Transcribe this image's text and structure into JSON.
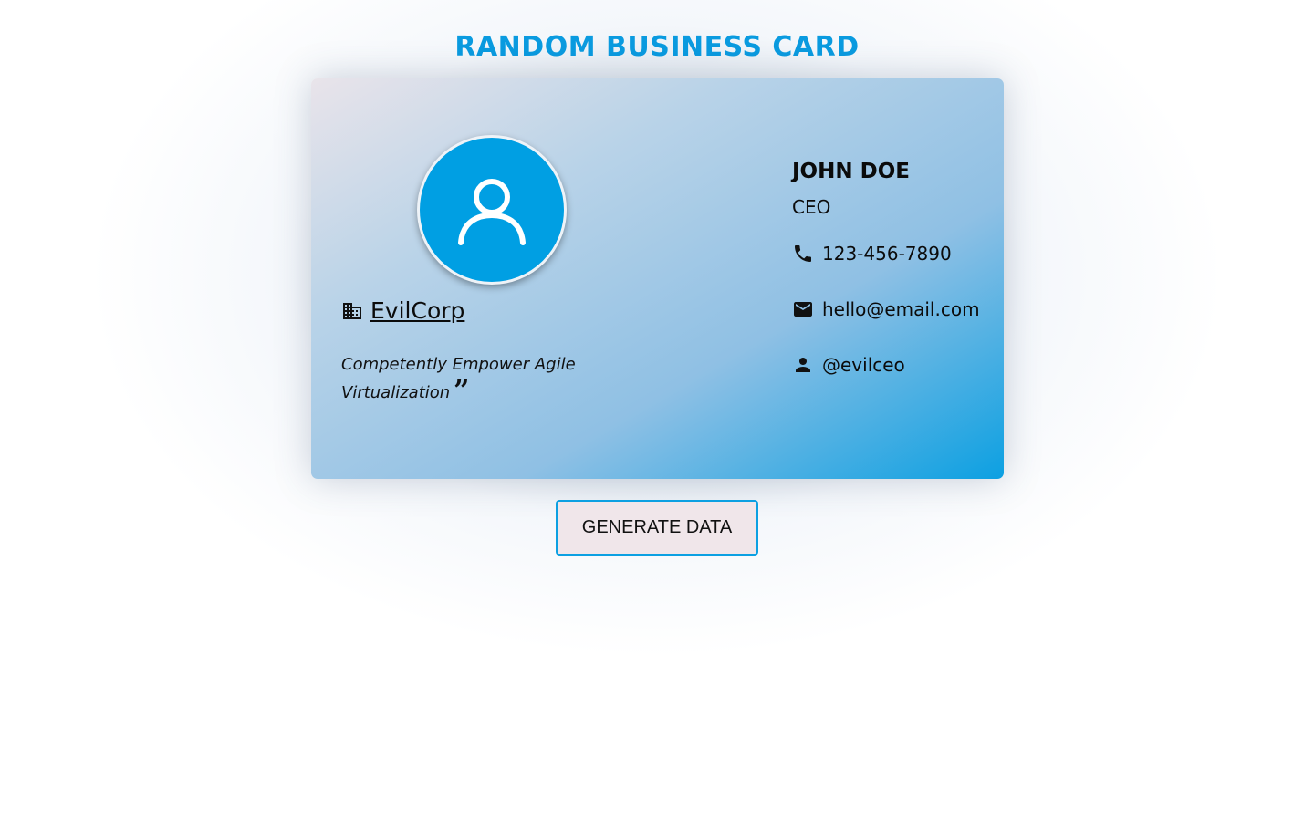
{
  "header": {
    "title": "RANDOM BUSINESS CARD"
  },
  "card": {
    "avatar_icon": "user-outline-icon",
    "company": {
      "icon": "building-icon",
      "name": "EvilCorp"
    },
    "slogan": "Competently Empower Agile Virtualization",
    "quote_icon": "closing-quote-icon",
    "person": {
      "name": "JOHN DOE",
      "role": "CEO"
    },
    "contacts": {
      "phone": {
        "icon": "phone-icon",
        "value": "123-456-7890"
      },
      "email": {
        "icon": "mail-icon",
        "value": "hello@email.com"
      },
      "handle": {
        "icon": "person-icon",
        "value": "@evilceo"
      }
    }
  },
  "actions": {
    "generate_label": "GENERATE DATA"
  },
  "colors": {
    "accent": "#0a9be0",
    "avatar_bg": "#009fe3",
    "button_bg": "#f0e6ea",
    "button_border": "#0ca0e2"
  }
}
